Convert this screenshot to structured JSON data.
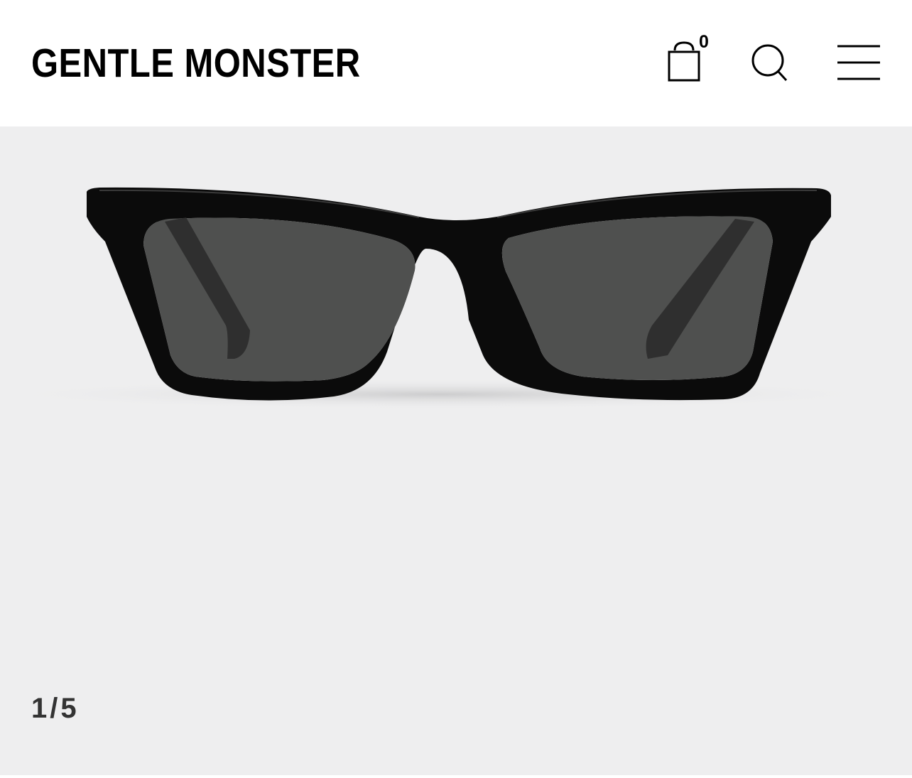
{
  "header": {
    "brand": "GENTLE MONSTER",
    "cart": {
      "icon": "shopping-bag-icon",
      "count": "0"
    },
    "search": {
      "icon": "search-icon"
    },
    "menu": {
      "icon": "hamburger-menu-icon"
    }
  },
  "gallery": {
    "background_color": "#eeeeef",
    "image_subject": "sunglasses-product-image",
    "counter": {
      "current": "1",
      "separator": "/",
      "total": "5"
    }
  },
  "colors": {
    "text": "#000000",
    "counter_text": "#333333",
    "frame": "#0a0a0a",
    "lens": "#4f504f"
  }
}
